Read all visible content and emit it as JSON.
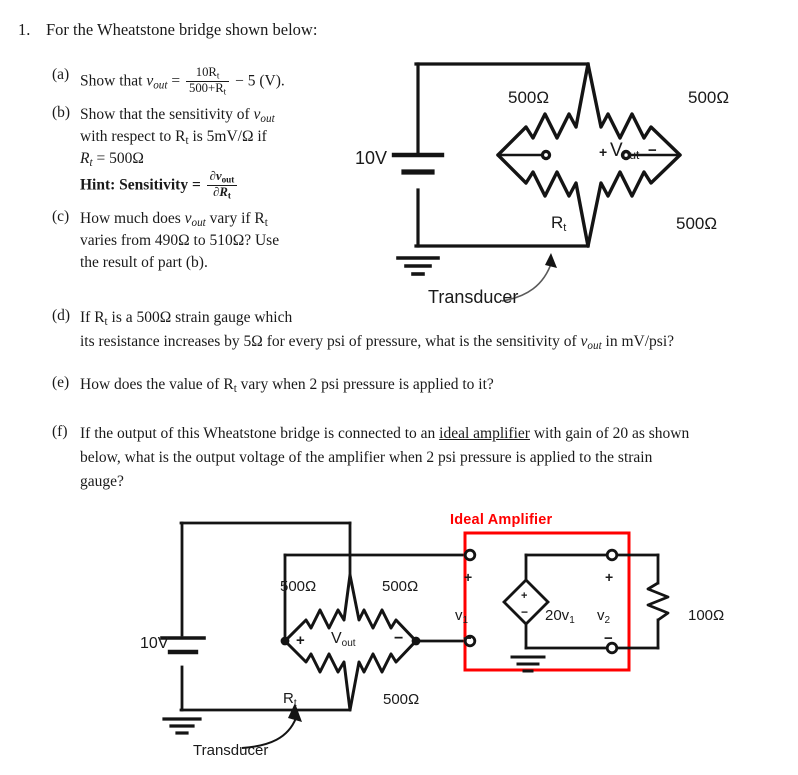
{
  "question": {
    "number": "1.",
    "stem": "For the Wheatstone bridge shown below:",
    "parts": [
      {
        "label": "(a)",
        "line1_pre": "Show that ",
        "var": "v",
        "var_sub": "out",
        "eq": "=",
        "frac_num": "10R",
        "frac_num_sub": "t",
        "frac_den": "500+R",
        "frac_den_sub": "t",
        "tail": "− 5 (V)."
      },
      {
        "label": "(b)",
        "line1": "Show that the sensitivity of ",
        "line2": "with respect to R",
        "line2b": " is 5mV/Ω if",
        "line3": "R",
        "line3b": " = 500Ω",
        "hint_label": "Hint: Sensitivity =",
        "hint_num": "∂v",
        "hint_num_sub": "out",
        "hint_den": "∂R",
        "hint_den_sub": "t"
      },
      {
        "label": "(c)",
        "line1a": "How much does ",
        "line1b": " vary if R",
        "line2": "varies from 490Ω to 510Ω? Use",
        "line3": "the result of part (b)."
      },
      {
        "label": "(d)",
        "line1": "If R",
        "line1b": " is a 500Ω strain gauge which",
        "line2a": "its resistance increases by 5Ω for every psi of pressure, what is the sensitivity of ",
        "line2b": " in mV/psi?"
      },
      {
        "label": "(e)",
        "line1a": "How does the value of R",
        "line1b": " vary when 2 psi pressure is applied to it?"
      },
      {
        "label": "(f)",
        "line1a": "If the output of this Wheatstone bridge is connected to an ",
        "line1_underline": "ideal amplifier",
        "line1b": " with gain of 20 as shown",
        "line2": "below, what is the output voltage of the amplifier when 2 psi pressure is applied to the strain",
        "line3": "gauge?"
      }
    ]
  },
  "circuit_top": {
    "source_label": "10V",
    "r_top_left": "500Ω",
    "r_top_right": "500Ω",
    "r_bottom_right": "500Ω",
    "r_bottom_left": "R",
    "r_bottom_left_sub": "t",
    "vout_plus": "+",
    "vout_label": "V",
    "vout_sub": "out",
    "vout_minus": "−",
    "transducer_label": "Transducer"
  },
  "circuit_bottom": {
    "source_label": "10V",
    "r_top_left": "500Ω",
    "r_top_right": "500Ω",
    "r_bottom_right": "500Ω",
    "r_bottom_left": "R",
    "r_bottom_left_sub": "t",
    "vout_plus": "+",
    "vout_label": "V",
    "vout_sub": "out",
    "vout_minus": "−",
    "transducer_label": "Transducer",
    "amplifier_title": "Ideal Amplifier",
    "amplifier_color": "#ff0000",
    "v1_label": "v",
    "v1_sub": "1",
    "v1_plus": "+",
    "v1_minus": "−",
    "dep_source_label": "20v",
    "dep_source_sub": "1",
    "dep_src_plus": "+",
    "dep_src_minus": "−",
    "v2_label": "v",
    "v2_sub": "2",
    "v2_plus": "+",
    "v2_minus": "−",
    "load_label": "100Ω"
  }
}
